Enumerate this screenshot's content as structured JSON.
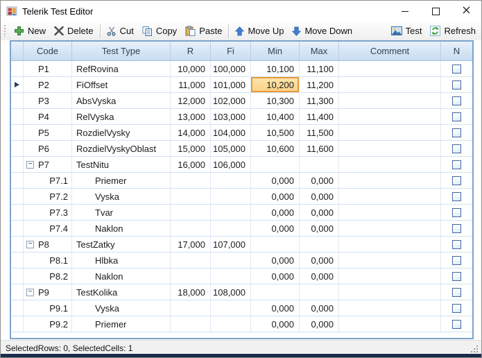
{
  "window": {
    "title": "Telerik Test Editor"
  },
  "toolbar": {
    "new": "New",
    "delete": "Delete",
    "cut": "Cut",
    "copy": "Copy",
    "paste": "Paste",
    "move_up": "Move Up",
    "move_down": "Move Down",
    "test": "Test",
    "refresh": "Refresh"
  },
  "grid": {
    "columns": [
      "",
      "Code",
      "Test Type",
      "R",
      "Fi",
      "Min",
      "Max",
      "Comment",
      "N"
    ],
    "selected_cell": {
      "row": "P2",
      "column": "Min",
      "value": "10,200"
    },
    "rows": [
      {
        "code": "P1",
        "type": "RefRovina",
        "r": "10,000",
        "fi": "100,000",
        "min": "10,100",
        "max": "11,100",
        "comment": "",
        "level": 0,
        "expander": false,
        "current": false,
        "checked": false
      },
      {
        "code": "P2",
        "type": "FiOffset",
        "r": "11,000",
        "fi": "101,000",
        "min": "10,200",
        "max": "11,200",
        "comment": "",
        "level": 0,
        "expander": false,
        "current": true,
        "selected_cell": "min",
        "checked": false
      },
      {
        "code": "P3",
        "type": "AbsVyska",
        "r": "12,000",
        "fi": "102,000",
        "min": "10,300",
        "max": "11,300",
        "comment": "",
        "level": 0,
        "expander": false,
        "current": false,
        "checked": false
      },
      {
        "code": "P4",
        "type": "RelVyska",
        "r": "13,000",
        "fi": "103,000",
        "min": "10,400",
        "max": "11,400",
        "comment": "",
        "level": 0,
        "expander": false,
        "current": false,
        "checked": false
      },
      {
        "code": "P5",
        "type": "RozdielVysky",
        "r": "14,000",
        "fi": "104,000",
        "min": "10,500",
        "max": "11,500",
        "comment": "",
        "level": 0,
        "expander": false,
        "current": false,
        "checked": false
      },
      {
        "code": "P6",
        "type": "RozdielVyskyOblast",
        "r": "15,000",
        "fi": "105,000",
        "min": "10,600",
        "max": "11,600",
        "comment": "",
        "level": 0,
        "expander": false,
        "current": false,
        "checked": false
      },
      {
        "code": "P7",
        "type": "TestNitu",
        "r": "16,000",
        "fi": "106,000",
        "min": "",
        "max": "",
        "comment": "",
        "level": 0,
        "expander": true,
        "current": false,
        "checked": false
      },
      {
        "code": "P7.1",
        "type": "Priemer",
        "r": "",
        "fi": "",
        "min": "0,000",
        "max": "0,000",
        "comment": "",
        "level": 1,
        "expander": false,
        "current": false,
        "checked": false
      },
      {
        "code": "P7.2",
        "type": "Vyska",
        "r": "",
        "fi": "",
        "min": "0,000",
        "max": "0,000",
        "comment": "",
        "level": 1,
        "expander": false,
        "current": false,
        "checked": false
      },
      {
        "code": "P7.3",
        "type": "Tvar",
        "r": "",
        "fi": "",
        "min": "0,000",
        "max": "0,000",
        "comment": "",
        "level": 1,
        "expander": false,
        "current": false,
        "checked": false
      },
      {
        "code": "P7.4",
        "type": "Naklon",
        "r": "",
        "fi": "",
        "min": "0,000",
        "max": "0,000",
        "comment": "",
        "level": 1,
        "expander": false,
        "current": false,
        "checked": false
      },
      {
        "code": "P8",
        "type": "TestZatky",
        "r": "17,000",
        "fi": "107,000",
        "min": "",
        "max": "",
        "comment": "",
        "level": 0,
        "expander": true,
        "current": false,
        "checked": false
      },
      {
        "code": "P8.1",
        "type": "Hlbka",
        "r": "",
        "fi": "",
        "min": "0,000",
        "max": "0,000",
        "comment": "",
        "level": 1,
        "expander": false,
        "current": false,
        "checked": false
      },
      {
        "code": "P8.2",
        "type": "Naklon",
        "r": "",
        "fi": "",
        "min": "0,000",
        "max": "0,000",
        "comment": "",
        "level": 1,
        "expander": false,
        "current": false,
        "checked": false
      },
      {
        "code": "P9",
        "type": "TestKolika",
        "r": "18,000",
        "fi": "108,000",
        "min": "",
        "max": "",
        "comment": "",
        "level": 0,
        "expander": true,
        "current": false,
        "checked": false
      },
      {
        "code": "P9.1",
        "type": "Vyska",
        "r": "",
        "fi": "",
        "min": "0,000",
        "max": "0,000",
        "comment": "",
        "level": 1,
        "expander": false,
        "current": false,
        "checked": false
      },
      {
        "code": "P9.2",
        "type": "Priemer",
        "r": "",
        "fi": "",
        "min": "0,000",
        "max": "0,000",
        "comment": "",
        "level": 1,
        "expander": false,
        "current": false,
        "checked": false
      }
    ]
  },
  "statusbar": {
    "text": "SelectedRows: 0, SelectedCells: 1"
  },
  "icons": {
    "app": "form-icon",
    "new": "plus-icon",
    "delete": "delete-x-icon",
    "cut": "scissors-icon",
    "copy": "copy-pages-icon",
    "paste": "clipboard-icon",
    "move_up": "arrow-up-icon",
    "move_down": "arrow-down-icon",
    "test": "picture-icon",
    "refresh": "refresh-arrows-icon",
    "row_indicator": "current-row-arrow",
    "expander": "collapse-minus-icon",
    "n": "checkbox"
  },
  "colors": {
    "selection_border": "#e8993c",
    "selection_fill": "#fbd288",
    "header_top": "#e9f1fb",
    "header_bottom": "#c9dcf0",
    "grid_border": "#7ba3cd",
    "grid_line": "#d2e2f2",
    "accent_blue": "#3a6ea5",
    "new_green": "#45a045",
    "status_bg": "#f1f1f1",
    "bottom_strip": "#1a2b4a"
  }
}
